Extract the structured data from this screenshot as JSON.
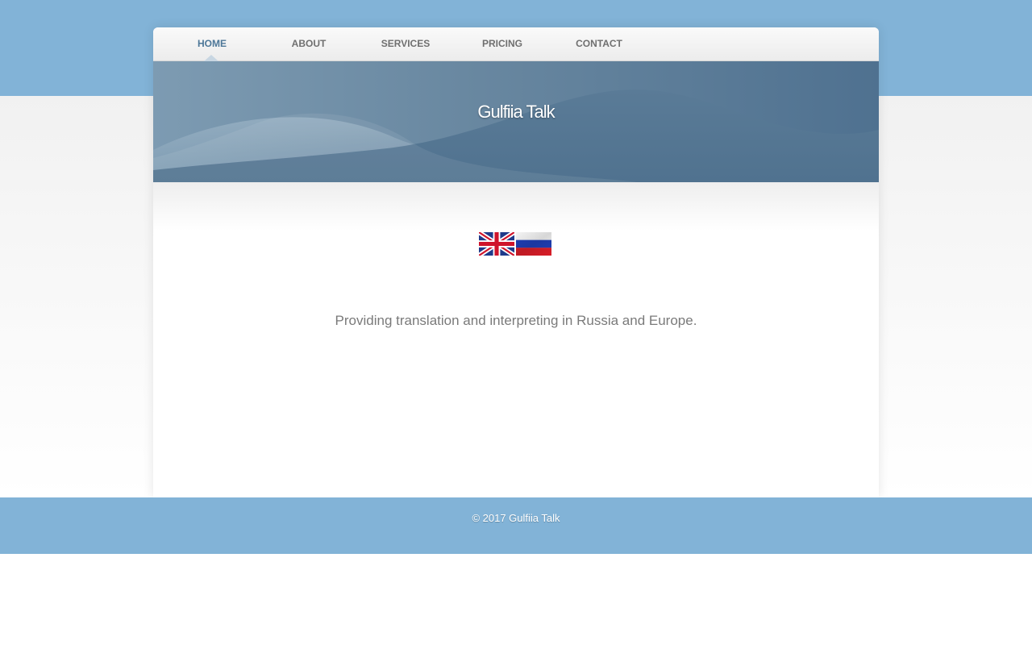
{
  "site": {
    "title": "Gulfiia Talk"
  },
  "nav": {
    "items": [
      {
        "label": "HOME",
        "active": true
      },
      {
        "label": "ABOUT",
        "active": false
      },
      {
        "label": "SERVICES",
        "active": false
      },
      {
        "label": "PRICING",
        "active": false
      },
      {
        "label": "CONTACT",
        "active": false
      }
    ]
  },
  "languages": [
    {
      "name": "English",
      "icon": "uk-flag-icon"
    },
    {
      "name": "Russian",
      "icon": "russia-flag-icon"
    }
  ],
  "main": {
    "tagline": "Providing translation and interpreting in Russia and Europe."
  },
  "footer": {
    "copyright": "© 2017 Gulfiia Talk"
  },
  "colors": {
    "band": "#82b3d7",
    "banner": "#53748f",
    "nav_active": "#4d7798",
    "nav_text": "#6f6f6f",
    "tagline": "#7a7a7a"
  }
}
